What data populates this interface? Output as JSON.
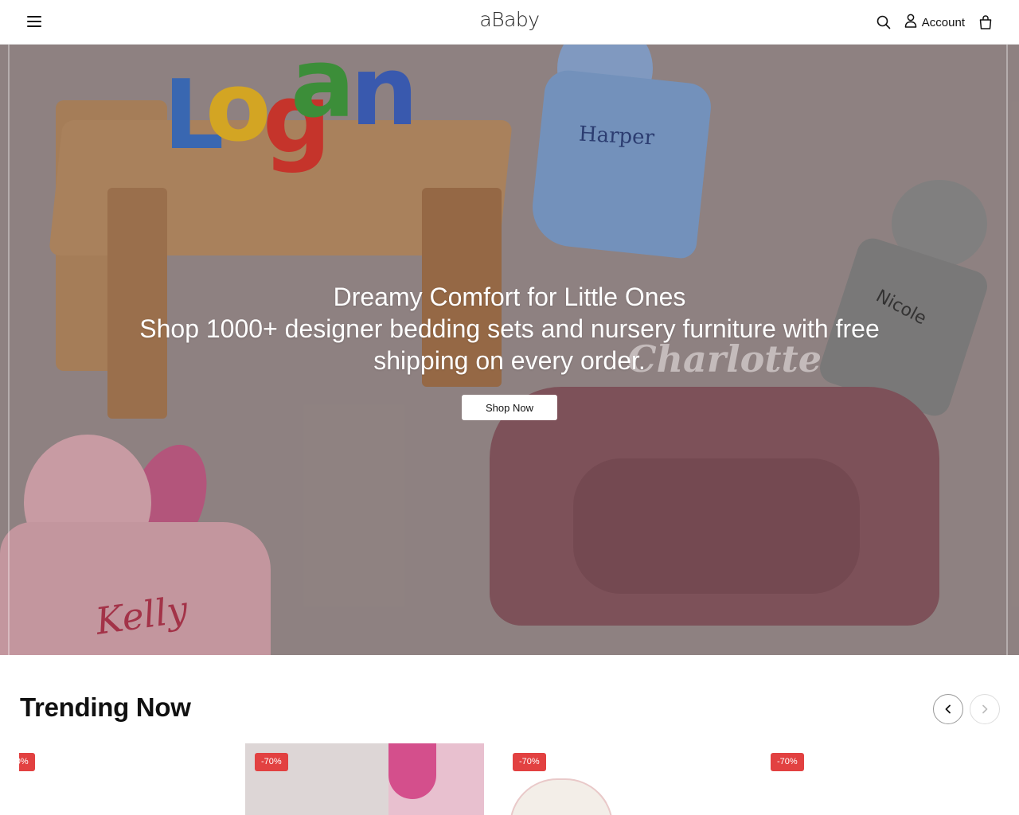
{
  "header": {
    "logo_text": "aBaby",
    "account_label": "Account",
    "icons": [
      "menu-icon",
      "search-icon",
      "user-icon",
      "bag-icon"
    ]
  },
  "hero": {
    "title": "Dreamy Comfort for Little Ones",
    "subtitle": "Shop 1000+ designer bedding sets and nursery furniture with free shipping on every order.",
    "cta_label": "Shop Now",
    "image_names": {
      "puzzle": [
        "L",
        "o",
        "g",
        "a",
        "n"
      ],
      "blanket_blue": "Harper",
      "blanket_gray": "Nicole",
      "chair": "Charlotte",
      "blanket_pink": "Kelly"
    }
  },
  "trending": {
    "title": "Trending Now",
    "cards": [
      {
        "badge": "-70%"
      },
      {
        "badge": "-70%"
      },
      {
        "badge": "-70%"
      },
      {
        "badge": "-70%"
      }
    ]
  },
  "colors": {
    "badge": "#e24141",
    "hero_bg": "#9a8d8c",
    "text": "#111111"
  }
}
